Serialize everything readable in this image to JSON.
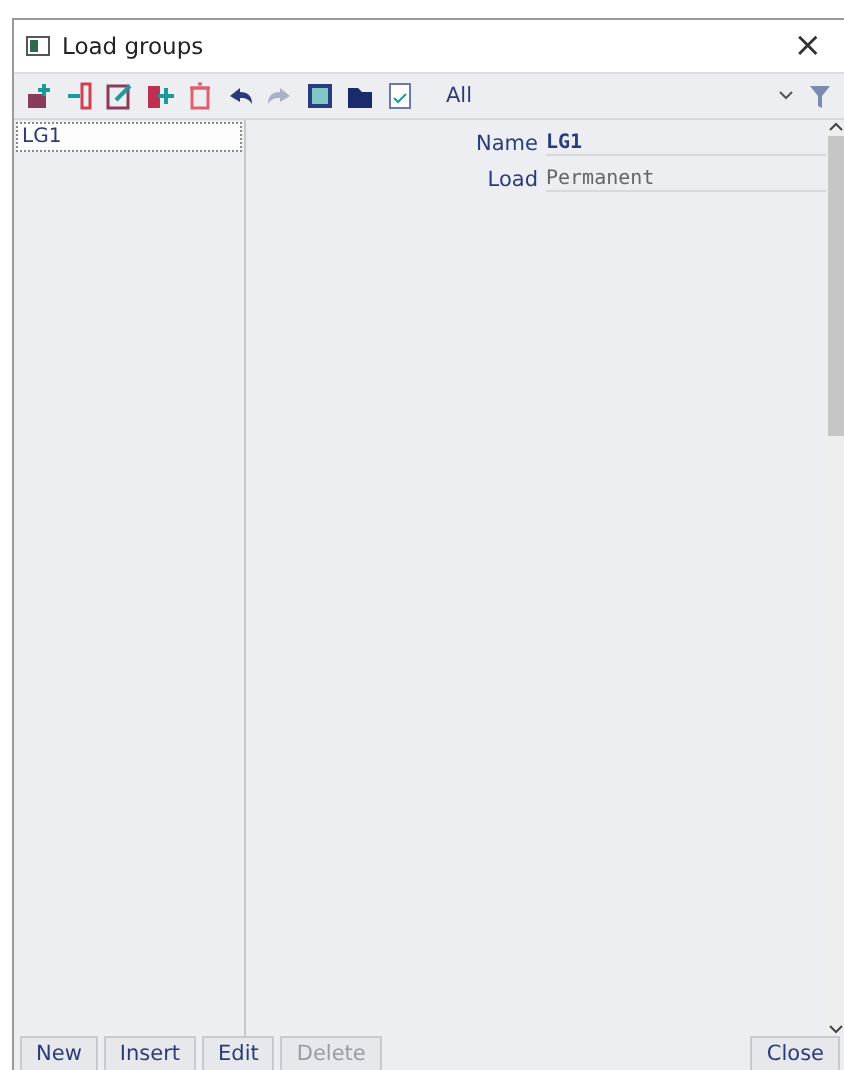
{
  "window": {
    "title": "Load groups",
    "close": "×"
  },
  "toolbar": {
    "filter": {
      "value": "All"
    }
  },
  "list": {
    "items": [
      {
        "label": "LG1",
        "selected": true
      }
    ]
  },
  "properties": [
    {
      "label": "Name",
      "value": "LG1",
      "bold": true
    },
    {
      "label": "Load",
      "value": "Permanent",
      "bold": false
    }
  ],
  "buttons": [
    {
      "label": "New",
      "disabled": false
    },
    {
      "label": "Insert",
      "disabled": false
    },
    {
      "label": "Edit",
      "disabled": false
    },
    {
      "label": "Delete",
      "disabled": true
    }
  ],
  "close_button": {
    "label": "Close",
    "disabled": false
  }
}
